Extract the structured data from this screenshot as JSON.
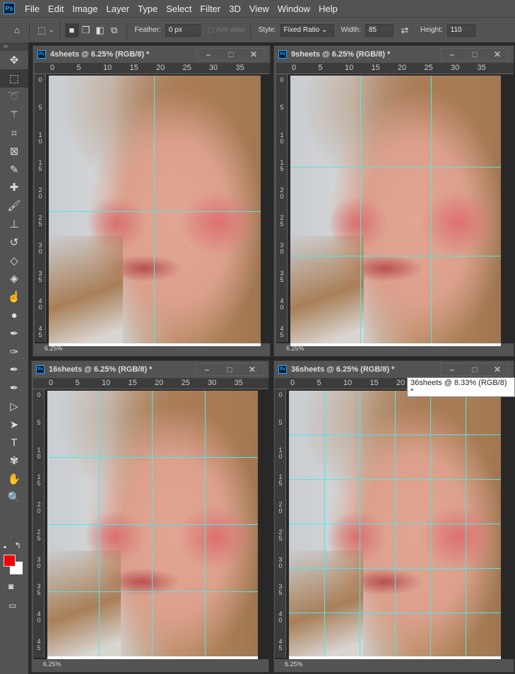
{
  "app": {
    "logo": "Ps"
  },
  "menu": [
    "File",
    "Edit",
    "Image",
    "Layer",
    "Type",
    "Select",
    "Filter",
    "3D",
    "View",
    "Window",
    "Help"
  ],
  "options": {
    "home_icon": "home-icon",
    "feather_label": "Feather:",
    "feather_value": "0 px",
    "antialias_label": "Anti-alias",
    "style_label": "Style:",
    "style_value": "Fixed Ratio",
    "width_label": "Width:",
    "width_value": "85",
    "height_label": "Height:",
    "height_value": "110"
  },
  "tools": [
    {
      "name": "move",
      "glyph": "✥"
    },
    {
      "name": "rect-marquee",
      "glyph": "⬚",
      "selected": true
    },
    {
      "name": "lasso",
      "glyph": "➰"
    },
    {
      "name": "magic-wand",
      "glyph": "⚚"
    },
    {
      "name": "crop",
      "glyph": "⌗"
    },
    {
      "name": "frame",
      "glyph": "⊠"
    },
    {
      "name": "eyedropper",
      "glyph": "✎"
    },
    {
      "name": "healing-brush",
      "glyph": "✚"
    },
    {
      "name": "brush",
      "glyph": "🖌"
    },
    {
      "name": "clone-stamp",
      "glyph": "⊥"
    },
    {
      "name": "history-brush",
      "glyph": "↺"
    },
    {
      "name": "eraser",
      "glyph": "◇"
    },
    {
      "name": "paint-bucket",
      "glyph": "◈"
    },
    {
      "name": "smudge",
      "glyph": "☝"
    },
    {
      "name": "dodge",
      "glyph": "●"
    },
    {
      "name": "pen",
      "glyph": "✒"
    },
    {
      "name": "freeform-pen",
      "glyph": "✑"
    },
    {
      "name": "add-anchor",
      "glyph": "✒"
    },
    {
      "name": "convert-point",
      "glyph": "✒"
    },
    {
      "name": "path-select",
      "glyph": "▷"
    },
    {
      "name": "direct-select",
      "glyph": "➤"
    },
    {
      "name": "type",
      "glyph": "T"
    },
    {
      "name": "custom-shape",
      "glyph": "✾"
    },
    {
      "name": "hand",
      "glyph": "✋"
    },
    {
      "name": "zoom",
      "glyph": "🔍"
    }
  ],
  "colors": {
    "foreground": "#e00000",
    "background": "#ffffff",
    "guide": "#4ee8e8"
  },
  "ruler": {
    "top": [
      "0",
      "5",
      "10",
      "15",
      "20",
      "25",
      "30",
      "35"
    ],
    "left": [
      "0",
      "5",
      "10",
      "15",
      "20",
      "25",
      "30",
      "35",
      "40",
      "45"
    ]
  },
  "windows": [
    {
      "title": "4sheets @ 6.25% (RGB/8) *",
      "zoom": "6.25%"
    },
    {
      "title": "9sheets @ 6.25% (RGB/8) *",
      "zoom": "6.25%"
    },
    {
      "title": "16sheets @ 6.25% (RGB/8) *",
      "zoom": "6.25%"
    },
    {
      "title": "36sheets @ 6.25% (RGB/8) *",
      "zoom": "6.25%"
    }
  ],
  "tooltip": "36sheets @ 8.33% (RGB/8) *"
}
